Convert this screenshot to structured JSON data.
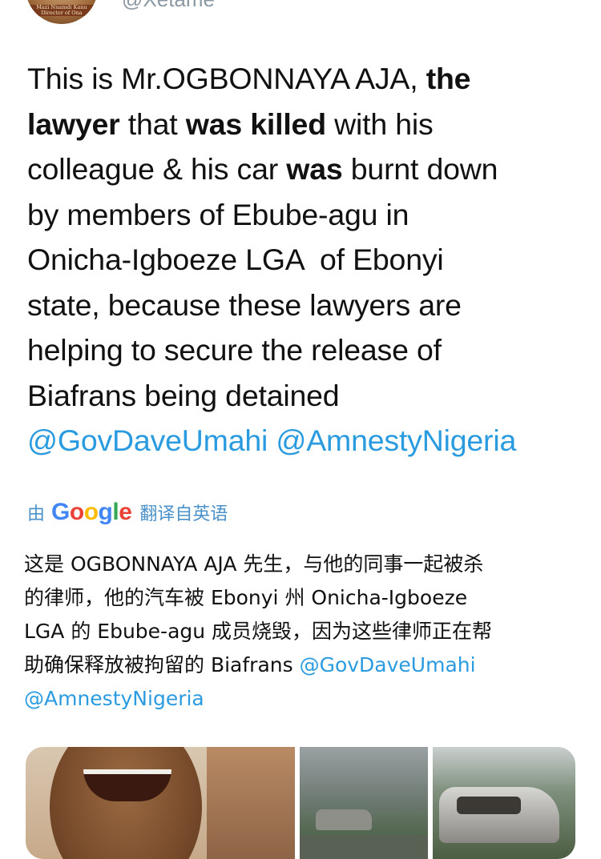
{
  "author": {
    "handle": "@Xetame",
    "avatar_text": "Mazi Nnamdi Kanu Director of Ona"
  },
  "tweet": {
    "lines": [
      [
        {
          "t": "This is Mr.OGBONNAYA AJA, "
        },
        {
          "t": "the",
          "b": true
        }
      ],
      [
        {
          "t": "lawyer",
          "b": true
        },
        {
          "t": " that "
        },
        {
          "t": "was killed",
          "b": true
        },
        {
          "t": " with his"
        }
      ],
      [
        {
          "t": "colleague & his car "
        },
        {
          "t": "was",
          "b": true
        },
        {
          "t": " burnt down"
        }
      ],
      [
        {
          "t": "by members of Ebube-agu in"
        }
      ],
      [
        {
          "t": "Onicha-Igboeze LGA  of Ebonyi"
        }
      ],
      [
        {
          "t": "state, because these lawyers are"
        }
      ],
      [
        {
          "t": "helping to secure the release of"
        }
      ],
      [
        {
          "t": "Biafrans being detained"
        }
      ],
      [
        {
          "t": "@GovDaveUmahi",
          "m": true
        },
        {
          "t": " "
        },
        {
          "t": "@AmnestyNigeria",
          "m": true
        }
      ]
    ]
  },
  "translation": {
    "prefix": "由",
    "brand": "Google",
    "suffix": "翻译自英语",
    "lines": [
      [
        {
          "t": "这是 OGBONNAYA AJA 先生，与他的同事一起被杀"
        }
      ],
      [
        {
          "t": "的律师，他的汽车被 Ebonyi 州 Onicha-Igboeze"
        }
      ],
      [
        {
          "t": "LGA 的 Ebube-agu 成员烧毁，因为这些律师正在帮"
        }
      ],
      [
        {
          "t": "助确保释放被拘留的 Biafrans "
        },
        {
          "t": "@GovDaveUmahi",
          "m": true
        }
      ],
      [
        {
          "t": "@AmnestyNigeria",
          "m": true
        }
      ]
    ]
  },
  "media": {
    "count": 3
  }
}
